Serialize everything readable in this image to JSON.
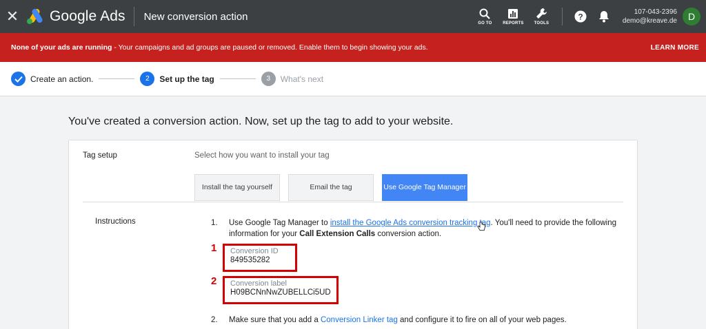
{
  "header": {
    "brand": "Google Ads",
    "page_title": "New conversion action",
    "tools": [
      {
        "label": "GO TO",
        "icon": "search-icon"
      },
      {
        "label": "REPORTS",
        "icon": "reports-icon"
      },
      {
        "label": "TOOLS",
        "icon": "wrench-icon"
      }
    ],
    "account_id": "107-043-2396",
    "account_email": "demo@kreave.de",
    "avatar_letter": "D"
  },
  "banner": {
    "bold_text": "None of your ads are running",
    "text": " - Your campaigns and ad groups are paused or removed. Enable them to begin showing your ads.",
    "learn_more": "LEARN MORE"
  },
  "stepper": {
    "steps": [
      {
        "label": "Create an action.",
        "state": "done"
      },
      {
        "number": "2",
        "label": "Set up the tag",
        "state": "active"
      },
      {
        "number": "3",
        "label": "What's next",
        "state": "upcoming"
      }
    ]
  },
  "main": {
    "headline": "You've created a conversion action. Now, set up the tag to add to your website.",
    "tag_setup": {
      "label": "Tag setup",
      "description": "Select how you want to install your tag",
      "tabs": [
        {
          "label": "Install the tag yourself",
          "selected": false
        },
        {
          "label": "Email the tag",
          "selected": false
        },
        {
          "label": "Use Google Tag Manager",
          "selected": true
        }
      ]
    },
    "instructions": {
      "label": "Instructions",
      "step1": {
        "number": "1.",
        "pre": "Use Google Tag Manager to ",
        "link": "install the Google Ads conversion tracking tag",
        "mid": ". You'll need to provide the following information for your ",
        "bold": "Call Extension Calls",
        "post": " conversion action."
      },
      "fields": [
        {
          "marker": "1",
          "label": "Conversion ID",
          "value": "849535282"
        },
        {
          "marker": "2",
          "label": "Conversion label",
          "value": "H09BCNnNwZUBELLCi5UD"
        }
      ],
      "step2": {
        "number": "2.",
        "pre": "Make sure that you add a ",
        "link": "Conversion Linker tag",
        "post": " and configure it to fire on all of your web pages."
      }
    }
  },
  "colors": {
    "topbar": "#3c4043",
    "banner": "#c5221f",
    "accent": "#1a73e8",
    "selected_tab": "#4285f4",
    "highlight_box": "#d50000",
    "avatar": "#2e7d32"
  }
}
